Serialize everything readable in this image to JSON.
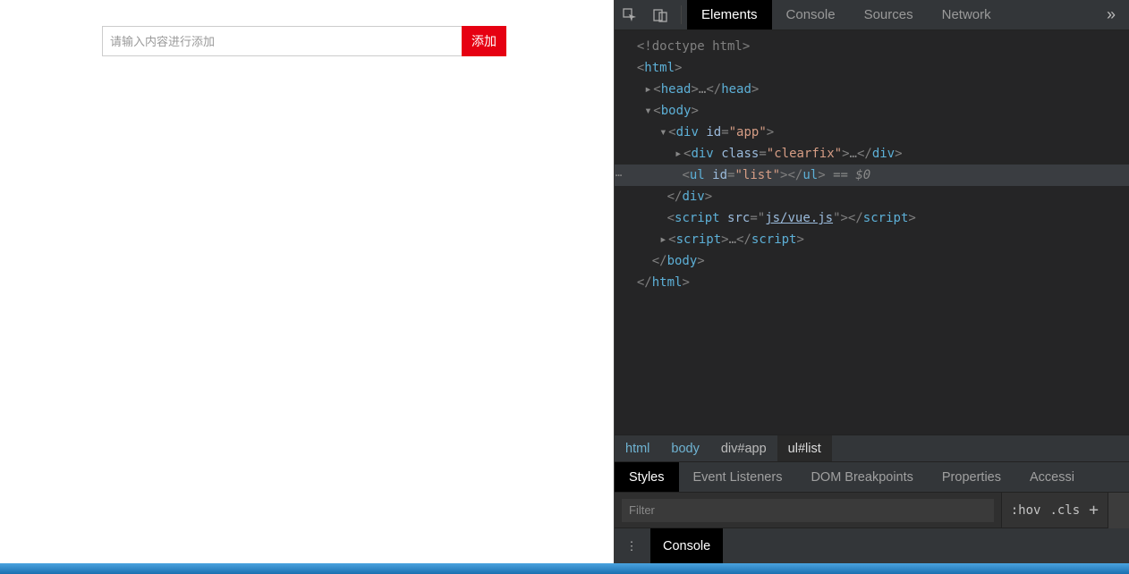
{
  "page": {
    "input_placeholder": "请输入内容进行添加",
    "add_button": "添加"
  },
  "devtools": {
    "tabs": [
      "Elements",
      "Console",
      "Sources",
      "Network"
    ],
    "active_tab": "Elements",
    "more_glyph": "»",
    "tree": {
      "l1": "<!doctype html>",
      "l2_open": "<",
      "l2_tag": "html",
      "l2_close": ">",
      "l3_head": "head",
      "l4_body": "body",
      "l5_div": "div",
      "l5_id_attr": "id",
      "l5_id_val": "\"app\"",
      "l6_div": "div",
      "l6_class_attr": "class",
      "l6_class_val": "\"clearfix\"",
      "l7_ul": "ul",
      "l7_id_attr": "id",
      "l7_id_val": "\"list\"",
      "l7_suffix": " == $0",
      "l8_close_div": "div",
      "l9_script": "script",
      "l9_src_attr": "src",
      "l9_src_val": "\"js/vue.js\"",
      "l10_script": "script",
      "l11_close_body": "body",
      "l12_close_html": "html",
      "ellipsis": "…"
    },
    "breadcrumb": [
      "html",
      "body",
      "div#app",
      "ul#list"
    ],
    "sub_tabs": [
      "Styles",
      "Event Listeners",
      "DOM Breakpoints",
      "Properties",
      "Accessi"
    ],
    "filter_placeholder": "Filter",
    "hov": ":hov",
    "cls": ".cls",
    "drawer_tab": "Console"
  }
}
